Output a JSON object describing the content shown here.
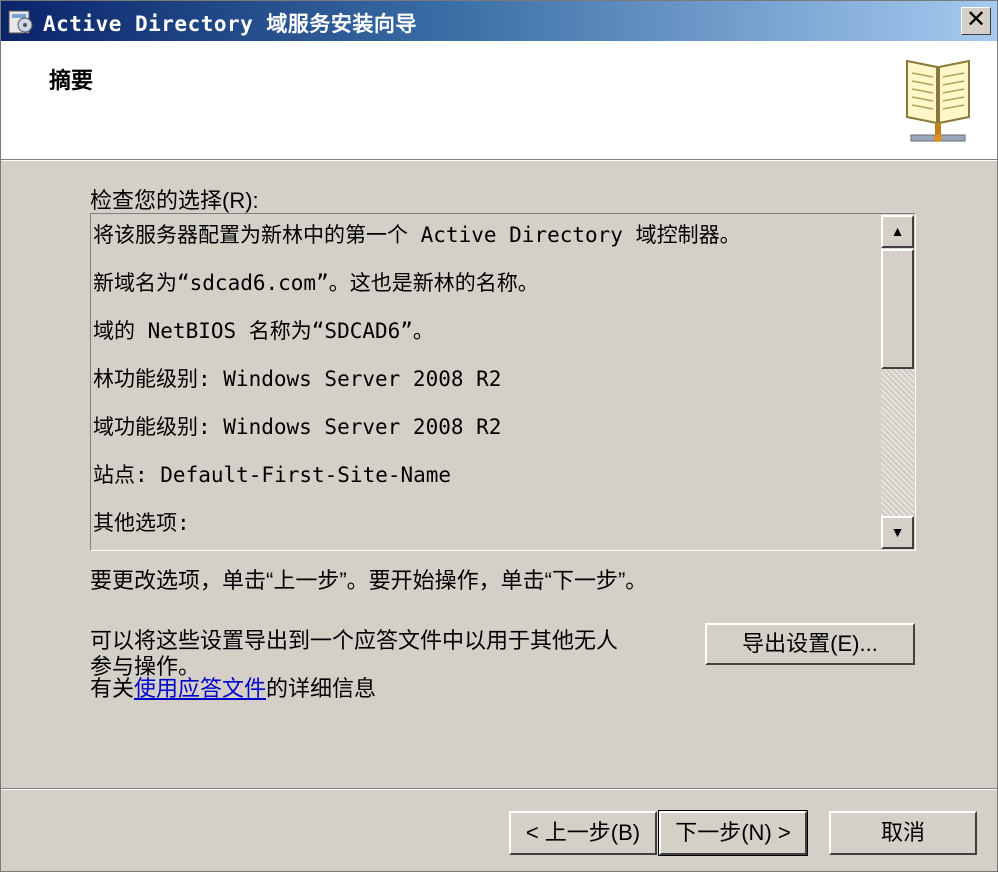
{
  "window": {
    "title": "Active Directory 域服务安装向导",
    "close_glyph": "✕"
  },
  "header": {
    "title": "摘要"
  },
  "review": {
    "label": "检查您的选择(R):",
    "lines": [
      "将该服务器配置为新林中的第一个 Active Directory 域控制器。",
      "新域名为“sdcad6.com”。这也是新林的名称。",
      "域的 NetBIOS 名称为“SDCAD6”。",
      "林功能级别: Windows Server 2008 R2",
      "域功能级别: Windows Server 2008 R2",
      "站点: Default-First-Site-Name",
      "其他选项:"
    ],
    "scroll_position": 0.0
  },
  "instructions": "要更改选项，单击“上一步”。要开始操作，单击“下一步”。",
  "export": {
    "text_line1": "可以将这些设置导出到一个应答文件中以用于其他无人",
    "text_line2": "参与操作。",
    "button_label": "导出设置(E)..."
  },
  "more_info": {
    "prefix": "有关",
    "link_text": "使用应答文件",
    "suffix": "的详细信息"
  },
  "buttons": {
    "back": "< 上一步(B)",
    "next": "下一步(N) >",
    "cancel": "取消"
  },
  "colors": {
    "titlebar_start": "#0a246a",
    "titlebar_end": "#a6caf0",
    "dialog_bg": "#d4d0c8",
    "link": "#0000cc"
  }
}
